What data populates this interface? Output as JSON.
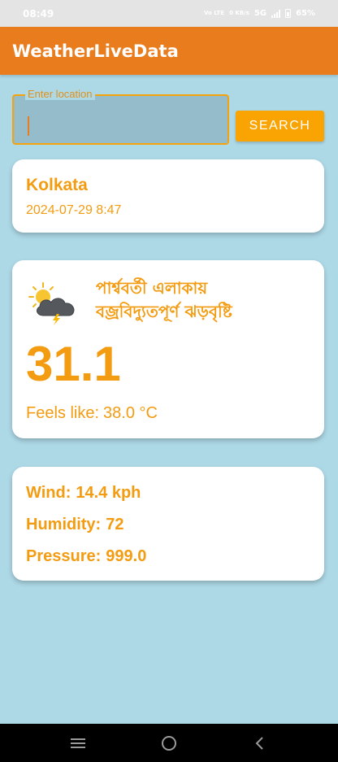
{
  "status_bar": {
    "time": "08:49",
    "volte": "Vo LTE",
    "speed": "0 KB/s",
    "network": "5G",
    "battery": "65%"
  },
  "app": {
    "title": "WeatherLiveData"
  },
  "search": {
    "label": "Enter location",
    "value": "",
    "button_label": "SEARCH"
  },
  "location": {
    "city": "Kolkata",
    "datetime": "2024-07-29 8:47"
  },
  "weather": {
    "icon": "thunderstorm-sun-icon",
    "condition_line1": "পার্শ্ববর্তী এলাকায়",
    "condition_line2": "বজ্রবিদ্যুতপূর্ণ ঝড়বৃষ্টি",
    "temperature": "31.1",
    "feels_like_label": "Feels like:",
    "feels_like_value": "38.0 °C"
  },
  "details": {
    "wind_label": "Wind:",
    "wind_value": "14.4 kph",
    "humidity_label": "Humidity:",
    "humidity_value": "72",
    "pressure_label": "Pressure:",
    "pressure_value": "999.0"
  },
  "nav": [
    "menu-icon",
    "home-circle-icon",
    "back-chevron-icon"
  ],
  "colors": {
    "background": "#ADD8E6",
    "app_bar": "#E97C1C",
    "accent_text": "#F39C12",
    "button": "#F9A403"
  }
}
